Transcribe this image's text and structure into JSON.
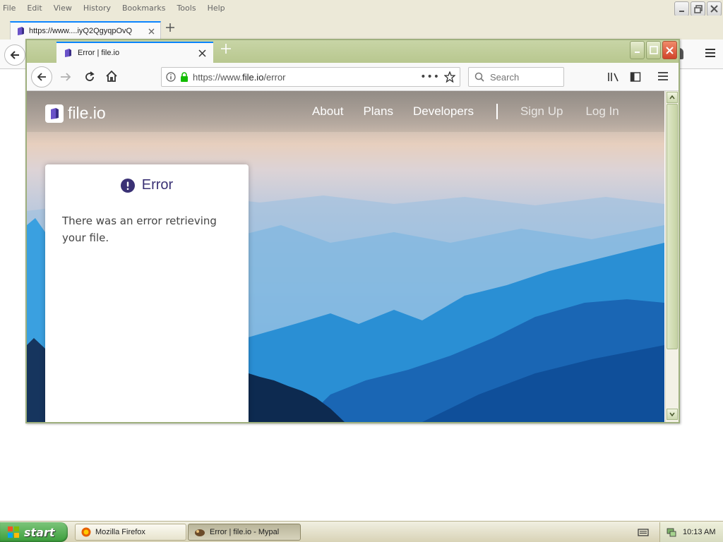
{
  "bg_window": {
    "menu": [
      "File",
      "Edit",
      "View",
      "History",
      "Bookmarks",
      "Tools",
      "Help"
    ],
    "tab_title": "https://www....iyQ2QgyqpOvQ"
  },
  "fg_window": {
    "tab_title": "Error | file.io",
    "url_prefix": "https://www.",
    "url_domain": "file.io",
    "url_path": "/error",
    "search_placeholder": "Search"
  },
  "site": {
    "logo": "file.io",
    "nav": [
      "About",
      "Plans",
      "Developers"
    ],
    "auth": [
      "Sign Up",
      "Log In"
    ]
  },
  "error": {
    "title": "Error",
    "message": "There was an error retrieving your file."
  },
  "taskbar": {
    "start": "start",
    "tasks": [
      "Mozilla Firefox",
      "Error | file.io - Mypal"
    ],
    "clock": "10:13 AM"
  },
  "colors": {
    "accent": "#0a84ff",
    "error_title": "#3a3175",
    "logo_purple": "#6a52c8",
    "lock_green": "#12bc00"
  }
}
